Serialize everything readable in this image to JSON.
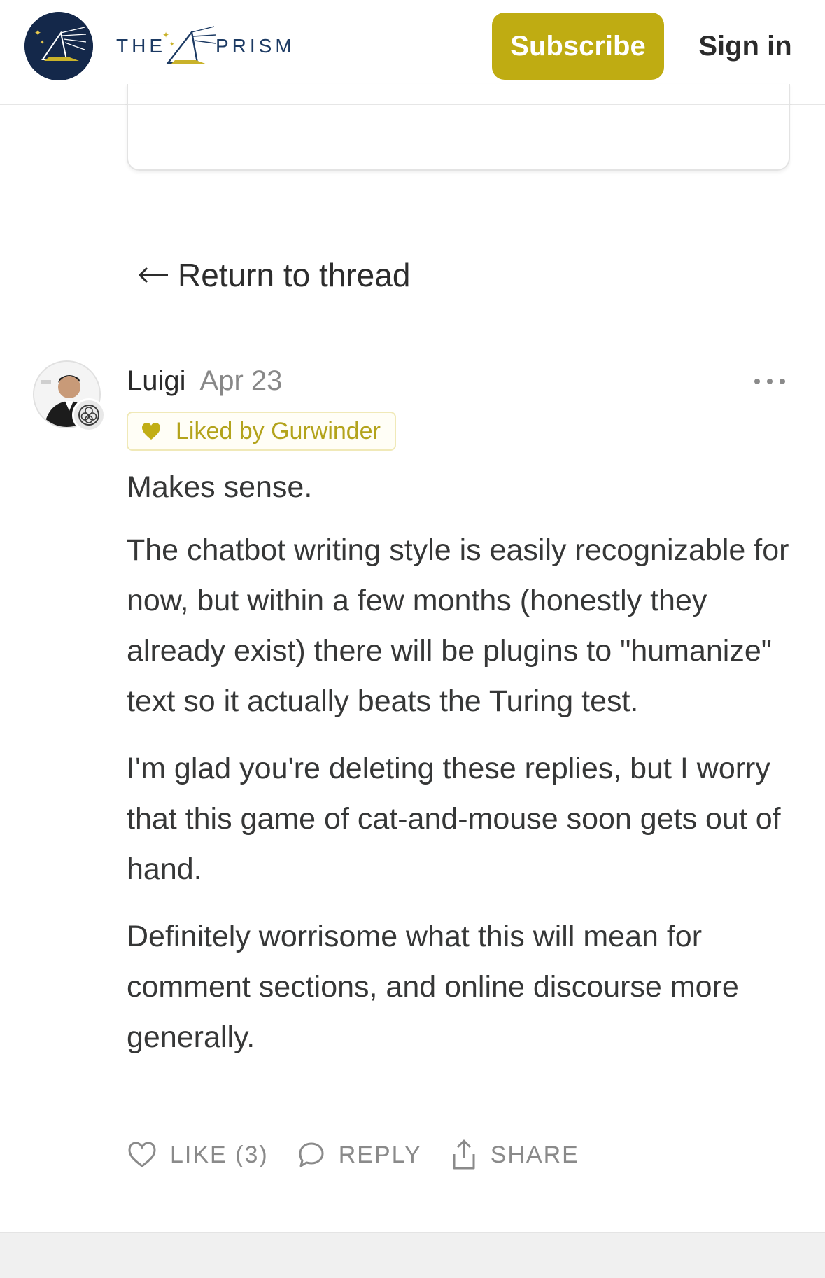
{
  "header": {
    "logo_icon": "prism-logo-icon",
    "wordmark_left": "THE",
    "wordmark_right": "PRISM",
    "subscribe_label": "Subscribe",
    "signin_label": "Sign in",
    "accent_color": "#bfac12",
    "logo_bg_color": "#14284a"
  },
  "nav": {
    "return_label": "Return to thread",
    "return_icon": "arrow-left-icon"
  },
  "comment": {
    "author": "Luigi",
    "date": "Apr 23",
    "liked_by": "Liked by Gurwinder",
    "paragraphs": [
      "Makes sense.",
      "The chatbot writing style is easily recognizable for now, but within a few months (honestly they already exist) there will be plugins to \"humanize\" text so it actually beats the Turing test.",
      "I'm glad you're deleting these replies, but I worry that this game of cat-and-mouse soon gets out of hand.",
      "Definitely worrisome what this will mean for comment sections, and online discourse more generally."
    ],
    "actions": {
      "like_label": "LIKE (3)",
      "reply_label": "REPLY",
      "share_label": "SHARE"
    }
  }
}
